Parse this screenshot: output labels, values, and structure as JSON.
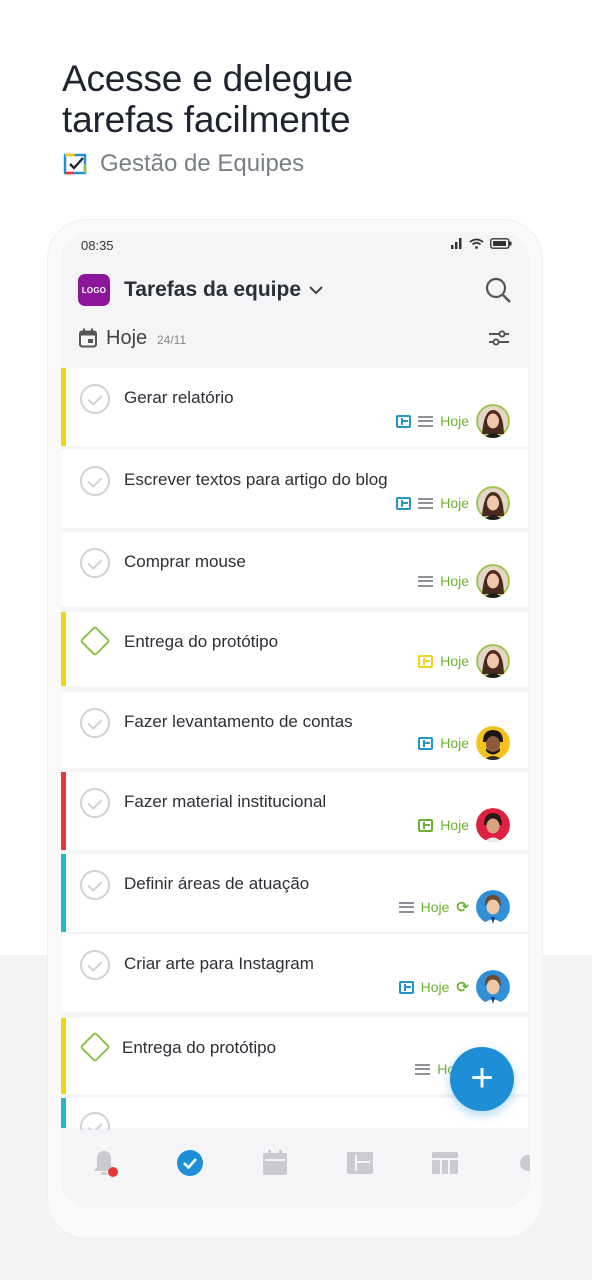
{
  "promo": {
    "headline_line1": "Acesse e delegue",
    "headline_line2": "tarefas facilmente",
    "subtitle": "Gestão de Equipes"
  },
  "status_bar": {
    "time": "08:35"
  },
  "header": {
    "logo_text": "LOGO",
    "title": "Tarefas da equipe"
  },
  "date_bar": {
    "label": "Hoje",
    "date": "24/11"
  },
  "tasks": [
    {
      "title": "Gerar relatório",
      "due": "Hoje",
      "stripe_color": "#f2d21b"
    },
    {
      "title": "Escrever textos para artigo do blog",
      "due": "Hoje",
      "stripe_color": ""
    },
    {
      "title": "Comprar mouse",
      "due": "Hoje",
      "stripe_color": ""
    },
    {
      "title": "Entrega do protótipo",
      "due": "Hoje",
      "stripe_color": "#f2d21b"
    },
    {
      "title": "Fazer levantamento de contas",
      "due": "Hoje",
      "stripe_color": ""
    },
    {
      "title": "Fazer material institucional",
      "due": "Hoje",
      "stripe_color": "#e53935"
    },
    {
      "title": "Definir áreas de atuação",
      "due": "Hoje",
      "stripe_color": "#26b8c9"
    },
    {
      "title": "Criar arte para Instagram",
      "due": "Hoje",
      "stripe_color": ""
    },
    {
      "title": "Entrega do protótipo",
      "due": "Hoje",
      "stripe_color": "#f2d21b"
    }
  ],
  "colors": {
    "accent": "#1e8fd6",
    "due_green": "#6bb42f",
    "logo_purple": "#8b169a"
  },
  "tab_bar": {
    "icons": [
      "bell-icon",
      "check-circle-icon",
      "calendar-icon",
      "board-icon",
      "table-icon",
      "more-icon"
    ]
  }
}
